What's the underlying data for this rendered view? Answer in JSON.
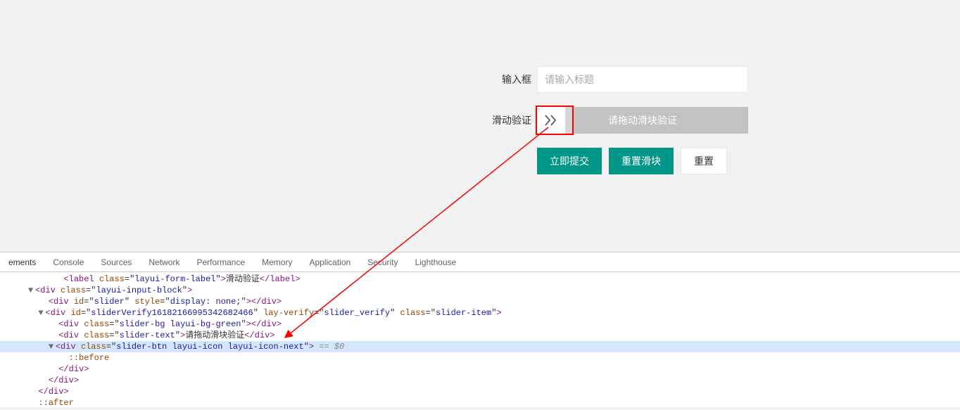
{
  "form": {
    "input_label": "输入框",
    "input_placeholder": "请输入标题",
    "slider_label": "滑动验证",
    "slider_text": "请拖动滑块验证",
    "submit_label": "立即提交",
    "reset_slider_label": "重置滑块",
    "reset_label": "重置"
  },
  "devtools": {
    "tabs": [
      "ements",
      "Console",
      "Sources",
      "Network",
      "Performance",
      "Memory",
      "Application",
      "Security",
      "Lighthouse"
    ],
    "dom": {
      "line0_text": "滑动验证",
      "line1_class": "layui-input-block",
      "line2_id": "slider",
      "line2_style": "display: none;",
      "line3_id": "sliderVerify16182166995342682466",
      "line3_layverify": "slider_verify",
      "line3_class": "slider-item",
      "line4_class": "slider-bg layui-bg-green",
      "line5_class": "slider-text",
      "line5_text": "请拖动滑块验证",
      "line6_class": "slider-btn layui-icon layui-icon-next",
      "line6_eq": " == $0",
      "line7_pseudo": "::before",
      "line8_close": "</div>",
      "line9_close": "</div>",
      "line10_close": "</div>",
      "line11_pseudo": "::after"
    }
  }
}
